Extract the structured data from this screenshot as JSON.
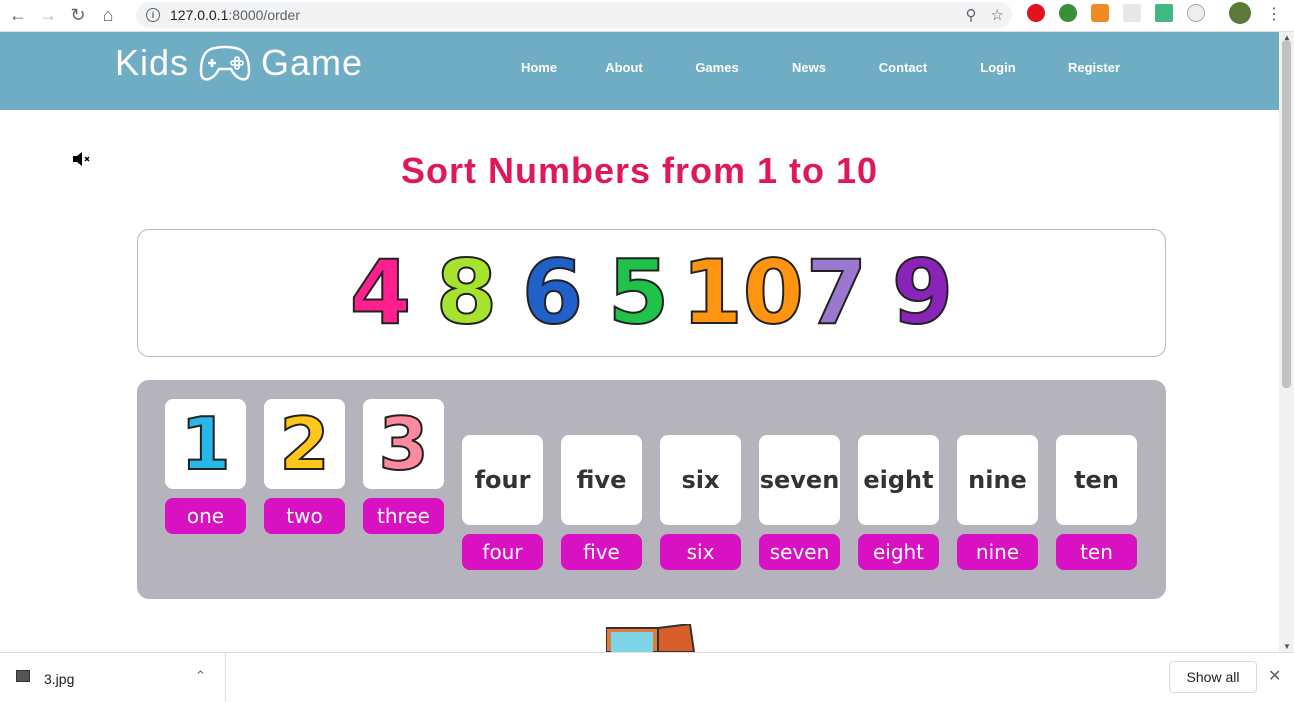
{
  "browser": {
    "url_host": "127.0.0.1",
    "url_path": ":8000/order"
  },
  "site": {
    "logo_left": "Kids",
    "logo_right": "Game",
    "nav": [
      "Home",
      "About",
      "Games",
      "News",
      "Contact",
      "Login",
      "Register"
    ]
  },
  "game": {
    "title": "Sort Numbers from 1 to 10",
    "mute_icon": "speaker-muted-icon",
    "pool": [
      {
        "n": "4",
        "color": "#ff1f8e"
      },
      {
        "n": "8",
        "color": "#a6e22e"
      },
      {
        "n": "6",
        "color": "#2060c8"
      },
      {
        "n": "5",
        "color": "#21c24a"
      },
      {
        "n": "10",
        "color": "#ff9410"
      },
      {
        "n": "7",
        "color": "#9b78d0"
      },
      {
        "n": "9",
        "color": "#8a24b8"
      }
    ],
    "placed": [
      {
        "n": "1",
        "color": "#26b8e8",
        "label": "one"
      },
      {
        "n": "2",
        "color": "#ffc61a",
        "label": "two"
      },
      {
        "n": "3",
        "color": "#ff8aa0",
        "label": "three"
      }
    ],
    "slots": [
      {
        "word": "four",
        "label": "four"
      },
      {
        "word": "five",
        "label": "five"
      },
      {
        "word": "six",
        "label": "six"
      },
      {
        "word": "seven",
        "label": "seven"
      },
      {
        "word": "eight",
        "label": "eight"
      },
      {
        "word": "nine",
        "label": "nine"
      },
      {
        "word": "ten",
        "label": "ten"
      }
    ]
  },
  "downloads": {
    "file": "3.jpg",
    "show_all": "Show all"
  },
  "colors": {
    "header": "#6eadc3",
    "title": "#e0185a",
    "label": "#d812c2",
    "tray": "#b5b4bc"
  }
}
